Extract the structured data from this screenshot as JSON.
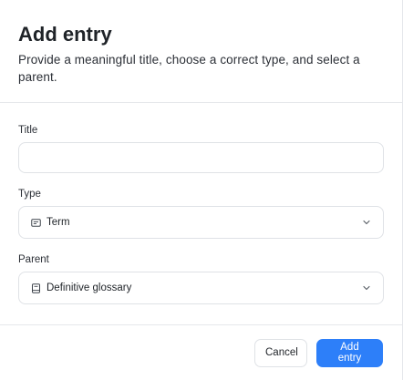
{
  "dialog": {
    "title": "Add entry",
    "subtitle": "Provide a meaningful title, choose a correct type, and select a parent."
  },
  "form": {
    "title_field": {
      "label": "Title",
      "value": "",
      "placeholder": ""
    },
    "type_field": {
      "label": "Type",
      "selected": "Term",
      "icon": "term-icon",
      "chevron": "chevron-down-icon"
    },
    "parent_field": {
      "label": "Parent",
      "selected": "Definitive glossary",
      "icon": "glossary-book-icon",
      "chevron": "chevron-down-icon"
    }
  },
  "footer": {
    "cancel_label": "Cancel",
    "submit_label": "Add entry"
  },
  "colors": {
    "primary": "#2d7ff9",
    "border": "#dfe2e6",
    "text": "#1f2328"
  }
}
